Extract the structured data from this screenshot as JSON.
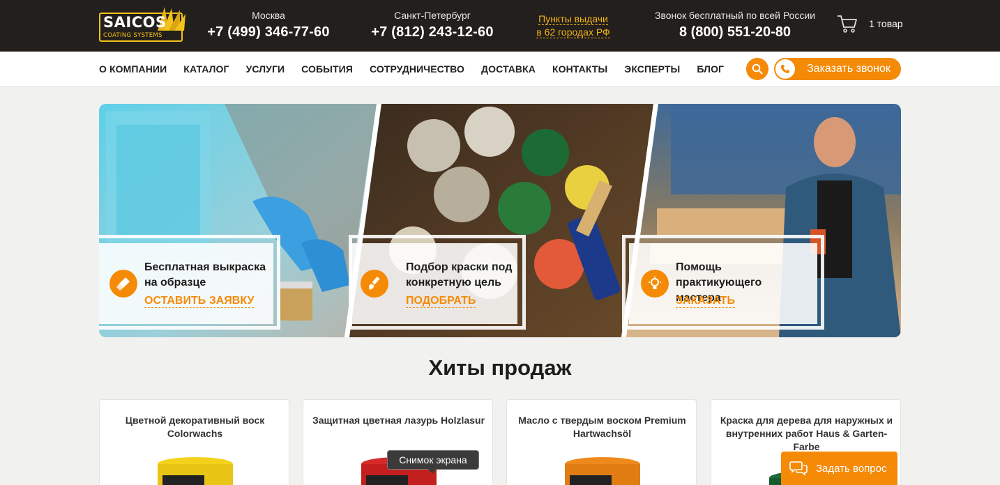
{
  "logo": {
    "word": "SAICOS",
    "sub": "COATING SYSTEMS"
  },
  "header": {
    "moscow": {
      "city": "Москва",
      "phone": "+7 (499) 346-77-60"
    },
    "spb": {
      "city": "Санкт-Петербург",
      "phone": "+7 (812) 243-12-60"
    },
    "pickup": {
      "line1": "Пункты выдачи",
      "line2": "в 62 городах РФ"
    },
    "free_call": {
      "label": "Звонок бесплатный по всей России",
      "phone": "8 (800) 551-20-80"
    },
    "cart": {
      "icon": "cart-icon",
      "count": "1 товар"
    }
  },
  "nav": {
    "items": [
      "О КОМПАНИИ",
      "КАТАЛОГ",
      "УСЛУГИ",
      "СОБЫТИЯ",
      "СОТРУДНИЧЕСТВО",
      "ДОСТАВКА",
      "КОНТАКТЫ",
      "ЭКСПЕРТЫ",
      "БЛОГ"
    ],
    "callback_label": "Заказать звонок"
  },
  "banner": {
    "cards": [
      {
        "title": "Бесплатная выкраска на образце",
        "link": "ОСТАВИТЬ ЗАЯВКУ",
        "icon": "brush-icon"
      },
      {
        "title": "Подбор краски под конкретную цель",
        "link": "ПОДОБРАТЬ",
        "icon": "paint-brush-icon"
      },
      {
        "title": "Помощь практикующего мастера",
        "link": "ЗАКАЗАТЬ",
        "icon": "lightbulb-icon"
      }
    ]
  },
  "hits": {
    "title": "Хиты продаж",
    "products": [
      {
        "name": "Цветной декоративный воск Colorwachs",
        "lid_color": "#f2d21b"
      },
      {
        "name": "Защитная цветная лазурь Holzlasur",
        "lid_color": "#d62a2a"
      },
      {
        "name": "Масло с твердым воском Premium Hartwachsöl",
        "lid_color": "#ee8a1b"
      },
      {
        "name": "Краска для дерева для наружных и внутренних работ Haus & Garten-Farbe",
        "lid_color": "#1f6a3a"
      }
    ]
  },
  "tooltip": "Снимок экрана",
  "ask_button": "Задать вопрос",
  "colors": {
    "accent": "#f58a07",
    "topbar": "#231f1c",
    "logo_yellow": "#f3c317"
  }
}
